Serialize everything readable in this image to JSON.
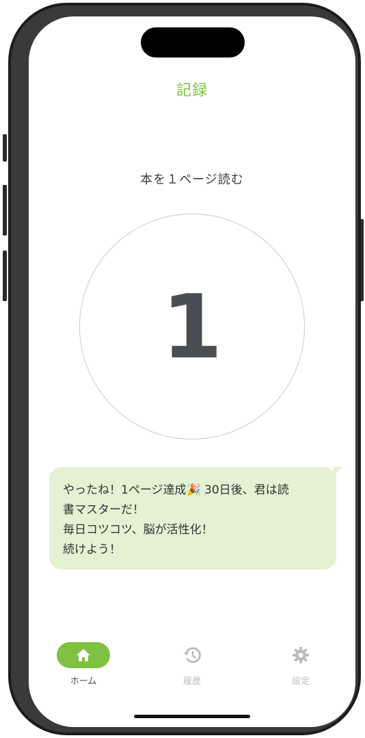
{
  "header": {
    "title": "記録"
  },
  "task": {
    "label": "本を１ページ読む"
  },
  "counter": {
    "value": "1"
  },
  "message": {
    "lines": [
      "やったね！1ページ達成🎉 30日後、君は読",
      "書マスターだ！",
      "毎日コツコツ、脳が活性化！",
      "続けよう！"
    ]
  },
  "tabs": [
    {
      "label": "ホーム",
      "icon": "home-icon",
      "active": true
    },
    {
      "label": "履歴",
      "icon": "history-icon",
      "active": false
    },
    {
      "label": "設定",
      "icon": "gear-icon",
      "active": false
    }
  ],
  "colors": {
    "accent": "#7fc241",
    "bubble": "#e3f2d2",
    "counter_text": "#4a4d52",
    "inactive": "#bcbcbc"
  }
}
